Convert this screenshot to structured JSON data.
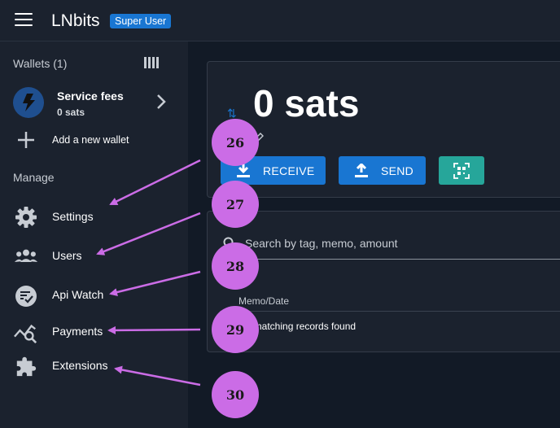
{
  "header": {
    "app_name": "LNbits",
    "badge": "Super User",
    "menu_icon": "hamburger-menu-icon"
  },
  "sidebar": {
    "wallets_title": "Wallets (1)",
    "wallet": {
      "name": "Service fees",
      "balance": "0 sats",
      "icon": "bolt-icon"
    },
    "add_wallet_label": "Add a new wallet",
    "manage_title": "Manage",
    "menu": [
      {
        "label": "Settings",
        "icon": "gear-icon"
      },
      {
        "label": "Users",
        "icon": "users-icon"
      },
      {
        "label": "Api Watch",
        "icon": "api-watch-icon"
      },
      {
        "label": "Payments",
        "icon": "payments-chart-icon"
      },
      {
        "label": "Extensions",
        "icon": "puzzle-icon"
      }
    ]
  },
  "balance_card": {
    "balance": "0 sats",
    "receive_label": "RECEIVE",
    "send_label": "SEND",
    "qr_icon": "qr-scan-icon"
  },
  "transactions": {
    "search_placeholder": "Search by tag, memo, amount",
    "column_memo_date": "Memo/Date",
    "empty_message": "No matching records found"
  },
  "callouts": [
    "26",
    "27",
    "28",
    "29",
    "30"
  ],
  "colors": {
    "accent": "#1976d2",
    "qr_button": "#26a69a",
    "callout": "#cb6ce6",
    "sidebar_bg": "#1b222e",
    "page_bg": "#121a26"
  }
}
